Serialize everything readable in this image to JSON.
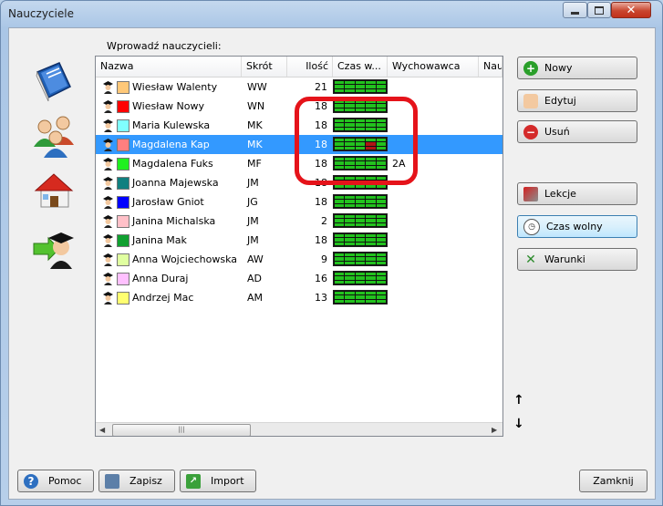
{
  "window": {
    "title": "Nauczyciele"
  },
  "list_label": "Wprowadź nauczycieli:",
  "columns": [
    "Nazwa",
    "Skrót",
    "Ilość",
    "Czas w...",
    "Wychowawca",
    "Nau"
  ],
  "teachers": [
    {
      "name": "Wiesław Walenty",
      "abbr": "WW",
      "count": "21",
      "color": "#ffc878",
      "homeroom": ""
    },
    {
      "name": "Wiesław Nowy",
      "abbr": "WN",
      "count": "18",
      "color": "#ff0000",
      "homeroom": ""
    },
    {
      "name": "Maria Kulewska",
      "abbr": "MK",
      "count": "18",
      "color": "#80ffff",
      "homeroom": ""
    },
    {
      "name": "Magdalena Kap",
      "abbr": "MK",
      "count": "18",
      "color": "#ff7f7f",
      "homeroom": "",
      "selected": true
    },
    {
      "name": "Magdalena Fuks",
      "abbr": "MF",
      "count": "18",
      "color": "#20f020",
      "homeroom": "2A"
    },
    {
      "name": "Joanna Majewska",
      "abbr": "JM",
      "count": "18",
      "color": "#108080",
      "homeroom": ""
    },
    {
      "name": "Jarosław Gniot",
      "abbr": "JG",
      "count": "18",
      "color": "#0000ff",
      "homeroom": ""
    },
    {
      "name": "Janina Michalska",
      "abbr": "JM",
      "count": "2",
      "color": "#ffc0c8",
      "homeroom": ""
    },
    {
      "name": "Janina Mak",
      "abbr": "JM",
      "count": "18",
      "color": "#10a030",
      "homeroom": ""
    },
    {
      "name": "Anna Wojciechowska",
      "abbr": "AW",
      "count": "9",
      "color": "#e0ffa0",
      "homeroom": ""
    },
    {
      "name": "Anna Duraj",
      "abbr": "AD",
      "count": "16",
      "color": "#ffc0ff",
      "homeroom": ""
    },
    {
      "name": "Andrzej Mac",
      "abbr": "AM",
      "count": "13",
      "color": "#ffff70",
      "homeroom": ""
    }
  ],
  "scroll_grip": "|||",
  "buttons": {
    "new": "Nowy",
    "edit": "Edytuj",
    "delete": "Usuń",
    "lessons": "Lekcje",
    "free_time": "Czas wolny",
    "conditions": "Warunki",
    "help": "Pomoc",
    "save": "Zapisz",
    "import": "Import",
    "close": "Zamknij"
  },
  "arrows": {
    "up": "↑",
    "down": "↓"
  }
}
